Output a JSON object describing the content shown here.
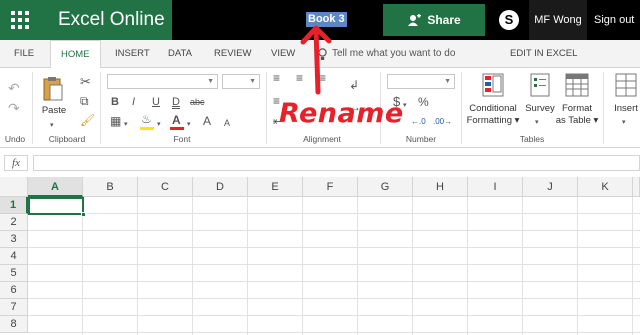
{
  "titlebar": {
    "app_name": "Excel Online",
    "doc_title": "Book 3",
    "share_label": "Share",
    "skype_glyph": "S",
    "user_name": "MF Wong",
    "signout_label": "Sign out",
    "brand_color": "#217346"
  },
  "tabs": [
    {
      "label": "FILE"
    },
    {
      "label": "HOME",
      "active": true
    },
    {
      "label": "INSERT"
    },
    {
      "label": "DATA"
    },
    {
      "label": "REVIEW"
    },
    {
      "label": "VIEW"
    },
    {
      "label": "EDIT IN EXCEL"
    }
  ],
  "tellme": {
    "label": "Tell me what you want to do",
    "icon": "lightbulb-icon"
  },
  "ribbon": {
    "groups": {
      "undo": "Undo",
      "clipboard": "Clipboard",
      "font": "Font",
      "alignment": "Alignment",
      "number": "Number",
      "tables": "Tables"
    },
    "paste_label": "Paste",
    "conditional_formatting": [
      "Conditional",
      "Formatting ▾"
    ],
    "survey_label": "Survey",
    "format_as_table": [
      "Format",
      "as Table ▾"
    ],
    "insert_label": "Insert",
    "font_buttons": {
      "bold": "B",
      "italic": "I",
      "underline": "U",
      "double_underline": "D",
      "strikethrough": "abc",
      "grow": "A",
      "shrink": "A"
    },
    "number_buttons": {
      "currency": "$",
      "percent": "%"
    }
  },
  "formula_bar": {
    "fx": "fx",
    "value": ""
  },
  "grid": {
    "columns": [
      "A",
      "B",
      "C",
      "D",
      "E",
      "F",
      "G",
      "H",
      "I",
      "J",
      "K"
    ],
    "rows": [
      "1",
      "2",
      "3",
      "4",
      "5",
      "6",
      "7",
      "8"
    ],
    "active_cell": "A1"
  },
  "annotation": {
    "text": "Rename",
    "color": "#e8202a"
  }
}
